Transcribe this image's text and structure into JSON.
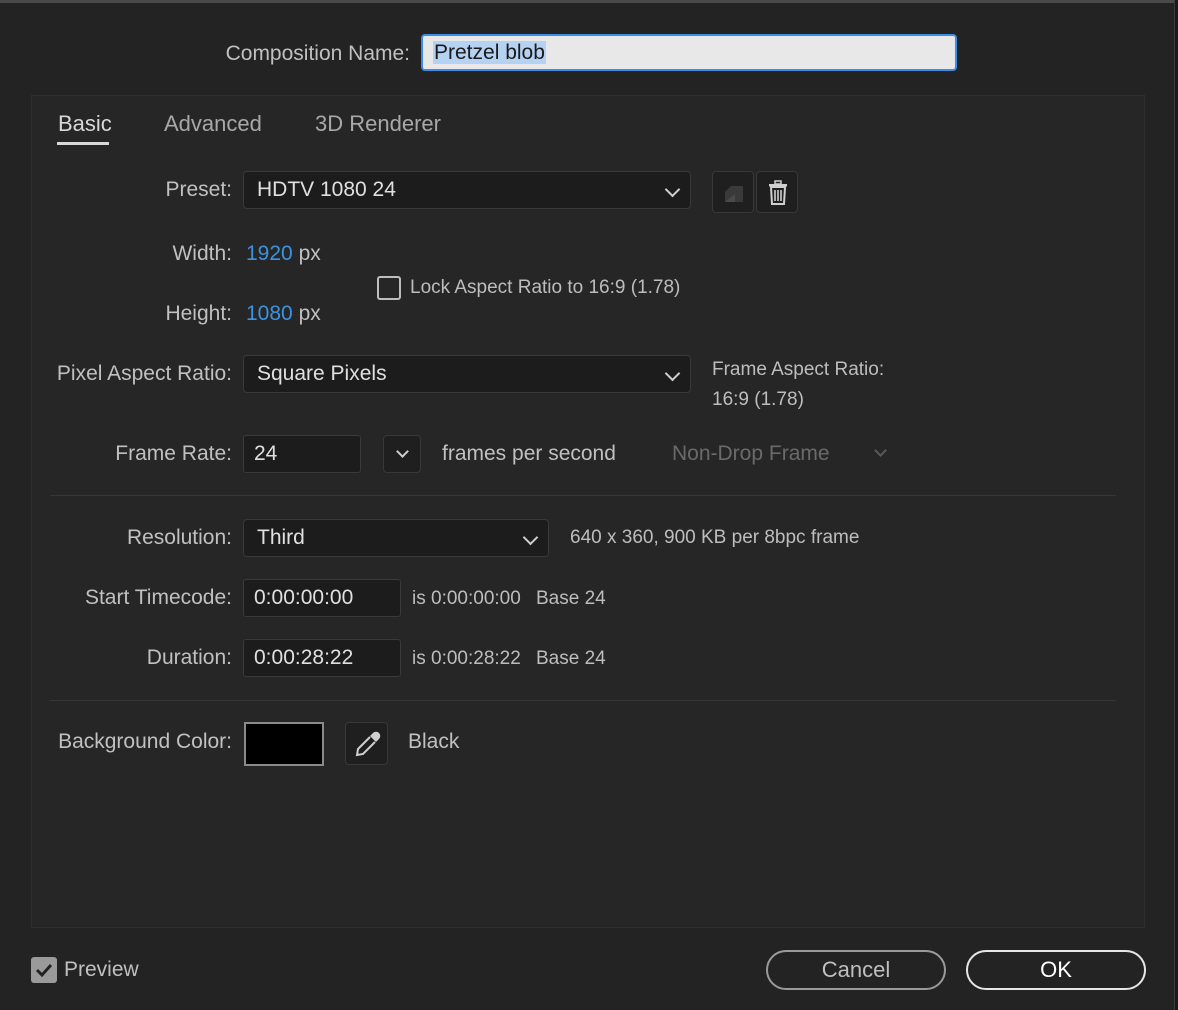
{
  "composition": {
    "name_label": "Composition Name:",
    "name_value": "Pretzel blob"
  },
  "tabs": [
    {
      "label": "Basic",
      "active": true
    },
    {
      "label": "Advanced",
      "active": false
    },
    {
      "label": "3D Renderer",
      "active": false
    }
  ],
  "preset": {
    "label": "Preset:",
    "value": "HDTV 1080 24"
  },
  "size": {
    "width_label": "Width:",
    "width_value": "1920",
    "width_unit": "px",
    "height_label": "Height:",
    "height_value": "1080",
    "height_unit": "px",
    "lock_label": "Lock Aspect Ratio to 16:9 (1.78)",
    "lock_checked": false
  },
  "pixel_aspect": {
    "label": "Pixel Aspect Ratio:",
    "value": "Square Pixels",
    "frame_aspect_label": "Frame Aspect Ratio:",
    "frame_aspect_value": "16:9 (1.78)"
  },
  "frame_rate": {
    "label": "Frame Rate:",
    "value": "24",
    "unit": "frames per second",
    "drop_frame": "Non-Drop Frame"
  },
  "resolution": {
    "label": "Resolution:",
    "value": "Third",
    "info": "640 x 360, 900 KB per 8bpc frame"
  },
  "start_timecode": {
    "label": "Start Timecode:",
    "value": "0:00:00:00",
    "is_text": "is 0:00:00:00",
    "base": "Base 24"
  },
  "duration": {
    "label": "Duration:",
    "value": "0:00:28:22",
    "is_text": "is 0:00:28:22",
    "base": "Base 24"
  },
  "background": {
    "label": "Background Color:",
    "color": "#000000",
    "name": "Black"
  },
  "footer": {
    "preview_label": "Preview",
    "preview_checked": true,
    "cancel_label": "Cancel",
    "ok_label": "OK"
  },
  "icons": [
    "save-preset-icon",
    "trash-icon",
    "chevron-down-icon",
    "eyedropper-icon",
    "checkmark-icon"
  ],
  "colors": {
    "accent": "#3a8ee6",
    "value_blue": "#3d93e0",
    "background": "#232323"
  }
}
